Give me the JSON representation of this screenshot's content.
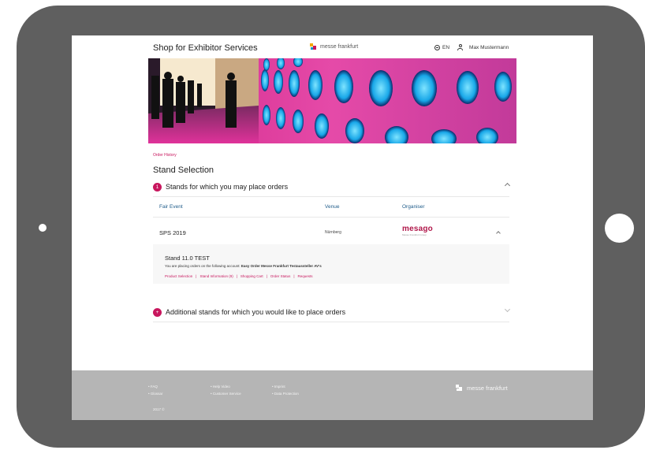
{
  "header": {
    "title": "Shop for Exhibitor Services",
    "brand": "messe frankfurt",
    "language": "EN",
    "user": "Max Mustermann"
  },
  "breadcrumb": "Order History",
  "page_title": "Stand Selection",
  "section1": {
    "number": "1",
    "title": "Stands for which you may place orders"
  },
  "table": {
    "headers": [
      "Fair Event",
      "Venue",
      "Organiser"
    ],
    "row": {
      "event": "SPS 2019",
      "venue": "Nürnberg",
      "organiser_logo": "mesago",
      "organiser_sub": "Messe Frankfurt Group"
    }
  },
  "stand": {
    "name": "Stand 11.0 TEST",
    "info_prefix": "You are placing orders on the following account:",
    "account": "Easy Order Messe Frankfurt Testaussteller AV's",
    "links": [
      "Product Selection",
      "Stand Information (9)",
      "Shopping Cart",
      "Order Status",
      "Requests"
    ]
  },
  "section2": {
    "icon": "+",
    "title": "Additional stands for which you would like to place orders"
  },
  "footer": {
    "col1": [
      "• FAQ",
      "• Glossar"
    ],
    "col2": [
      "• Help Video",
      "• Customer Service"
    ],
    "col3": [
      "• Imprint",
      "• Data Protection"
    ],
    "copyright": "2017 ©",
    "brand": "messe frankfurt"
  },
  "colors": {
    "accent": "#c8175e",
    "frame": "#5f5f5f",
    "footer": "#b5b5b5",
    "link_blue": "#1f5c8a"
  }
}
